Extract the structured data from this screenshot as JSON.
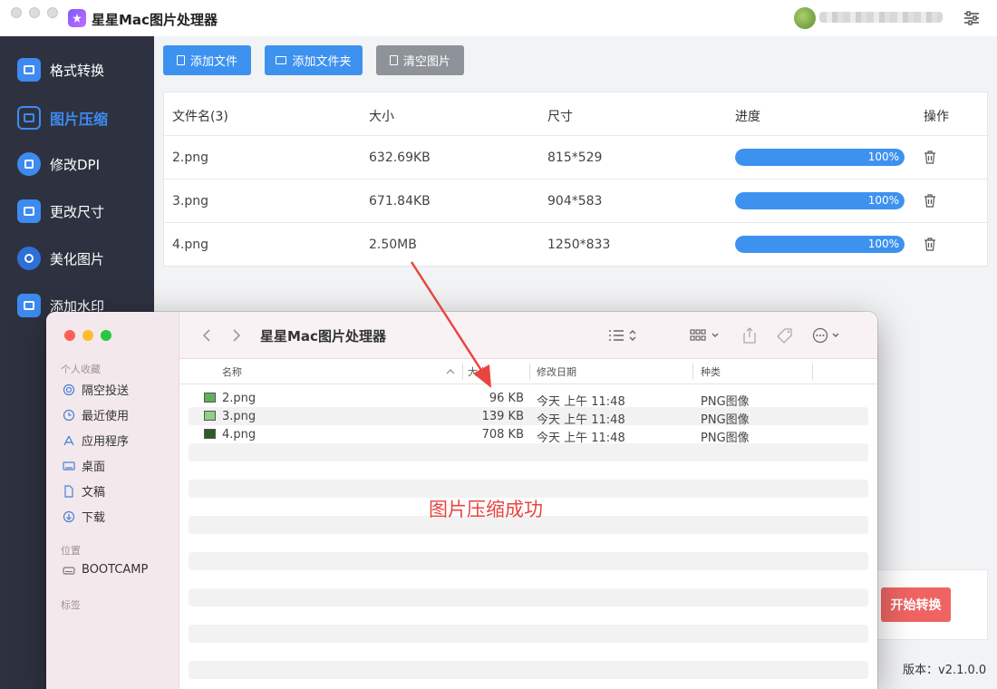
{
  "app": {
    "title": "星星Mac图片处理器",
    "version": "版本：v2.1.0.0",
    "start_button": "开始转换"
  },
  "sidebar": {
    "items": [
      {
        "label": "格式转换",
        "icon": "format-convert-icon"
      },
      {
        "label": "图片压缩",
        "icon": "image-compress-icon",
        "active": true
      },
      {
        "label": "修改DPI",
        "icon": "dpi-icon"
      },
      {
        "label": "更改尺寸",
        "icon": "resize-icon"
      },
      {
        "label": "美化图片",
        "icon": "beautify-icon"
      },
      {
        "label": "添加水印",
        "icon": "watermark-icon"
      }
    ]
  },
  "toolbar": {
    "add_file": "添加文件",
    "add_folder": "添加文件夹",
    "clear": "清空图片"
  },
  "table": {
    "headers": {
      "name": "文件名(3)",
      "size": "大小",
      "dimensions": "尺寸",
      "progress": "进度",
      "action": "操作"
    },
    "rows": [
      {
        "name": "2.png",
        "size": "632.69KB",
        "dimensions": "815*529",
        "progress": 100,
        "progress_label": "100%"
      },
      {
        "name": "3.png",
        "size": "671.84KB",
        "dimensions": "904*583",
        "progress": 100,
        "progress_label": "100%"
      },
      {
        "name": "4.png",
        "size": "2.50MB",
        "dimensions": "1250*833",
        "progress": 100,
        "progress_label": "100%"
      }
    ]
  },
  "finder": {
    "title": "星星Mac图片处理器",
    "sections": {
      "favorites": "个人收藏",
      "locations": "位置",
      "tags": "标签"
    },
    "favorites": [
      {
        "label": "隔空投送",
        "icon": "airdrop-icon"
      },
      {
        "label": "最近使用",
        "icon": "clock-icon"
      },
      {
        "label": "应用程序",
        "icon": "applications-icon"
      },
      {
        "label": "桌面",
        "icon": "desktop-icon"
      },
      {
        "label": "文稿",
        "icon": "document-icon"
      },
      {
        "label": "下载",
        "icon": "download-icon"
      }
    ],
    "locations": [
      {
        "label": "BOOTCAMP",
        "icon": "disk-icon"
      }
    ],
    "columns": {
      "name": "名称",
      "size": "大小",
      "date": "修改日期",
      "kind": "种类"
    },
    "files": [
      {
        "name": "2.png",
        "size": "96 KB",
        "date": "今天 上午 11:48",
        "kind": "PNG图像"
      },
      {
        "name": "3.png",
        "size": "139 KB",
        "date": "今天 上午 11:48",
        "kind": "PNG图像"
      },
      {
        "name": "4.png",
        "size": "708 KB",
        "date": "今天 上午 11:48",
        "kind": "PNG图像"
      }
    ]
  },
  "annotation": {
    "text": "图片压缩成功",
    "color": "#e8453f"
  },
  "colors": {
    "accent": "#3e92ef",
    "sidebar_bg": "#2e3240",
    "start_button": "#ef6462"
  }
}
